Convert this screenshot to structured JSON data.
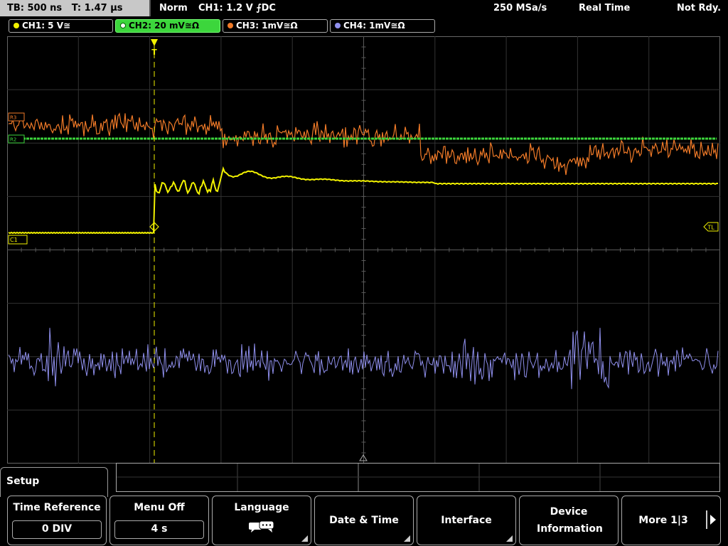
{
  "top": {
    "timebase": "TB: 500 ns",
    "trigger_time": "T: 1.47 µs",
    "trigger_mode": "Norm",
    "trigger_info": "CH1: 1.2 V ⨍DC",
    "sample_rate": "250 MSa/s",
    "acq_mode": "Real Time",
    "status": "Not Rdy."
  },
  "channels": [
    {
      "label": "CH1: 5 V≅",
      "color": "#f2f200",
      "active": false
    },
    {
      "label": "CH2: 20 mV≅Ω",
      "color": "#3cd63c",
      "active": true
    },
    {
      "label": "CH3: 1mV≅Ω",
      "color": "#f07a28",
      "active": false
    },
    {
      "label": "CH4: 1mV≅Ω",
      "color": "#9090ee",
      "active": false
    }
  ],
  "markers": {
    "trigger": "T",
    "trigger_level": "TL",
    "ch1": "C1",
    "ch3": "R3",
    "ch2": "R2"
  },
  "menu": {
    "title": "Setup",
    "time_reference": {
      "label": "Time Reference",
      "value": "0 DIV"
    },
    "menu_off": {
      "label": "Menu Off",
      "value": "4 s"
    },
    "language": {
      "label": "Language",
      "icon": "speech-bubbles-icon"
    },
    "date_time": {
      "label": "Date & Time"
    },
    "interface": {
      "label": "Interface"
    },
    "device_info": {
      "label": "Device Information"
    },
    "more": {
      "label": "More 1|3"
    }
  }
}
